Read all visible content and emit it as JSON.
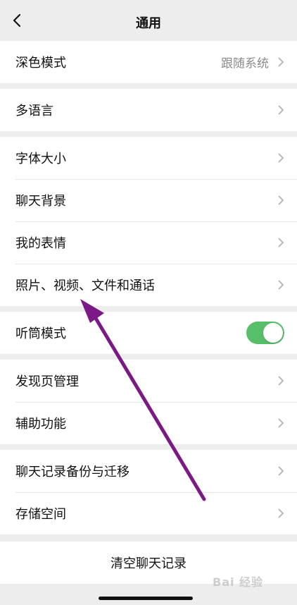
{
  "nav": {
    "title": "通用"
  },
  "groups": {
    "g1": [
      {
        "label": "深色模式",
        "value": "跟随系统"
      }
    ],
    "g2": [
      {
        "label": "多语言"
      }
    ],
    "g3": [
      {
        "label": "字体大小"
      },
      {
        "label": "聊天背景"
      },
      {
        "label": "我的表情"
      },
      {
        "label": "照片、视频、文件和通话"
      }
    ],
    "g4": [
      {
        "label": "听筒模式",
        "toggle_on": true
      }
    ],
    "g5": [
      {
        "label": "发现页管理"
      },
      {
        "label": "辅助功能"
      }
    ],
    "g6": [
      {
        "label": "聊天记录备份与迁移"
      },
      {
        "label": "存储空间"
      }
    ],
    "g7": {
      "label": "清空聊天记录"
    }
  },
  "watermark": {
    "text": "Bai 经验"
  },
  "colors": {
    "toggle": "#57be6a",
    "annotation_arrow": "#7b1a86",
    "background": "#ededed"
  }
}
